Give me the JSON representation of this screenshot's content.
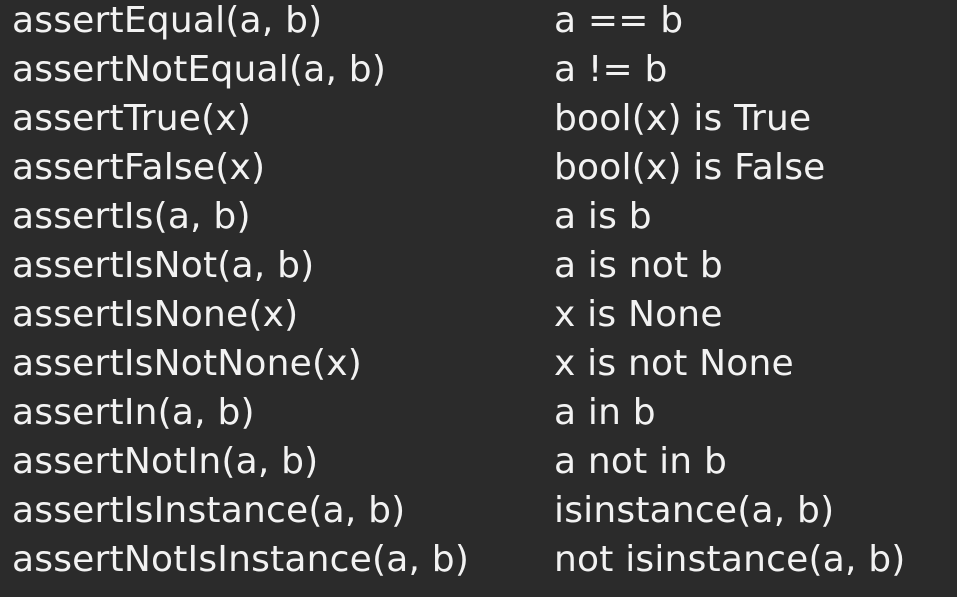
{
  "assertions": [
    {
      "method": "assertEqual(a, b)",
      "equivalent": "a == b"
    },
    {
      "method": "assertNotEqual(a, b)",
      "equivalent": "a != b"
    },
    {
      "method": "assertTrue(x)",
      "equivalent": "bool(x) is True"
    },
    {
      "method": "assertFalse(x)",
      "equivalent": "bool(x) is False"
    },
    {
      "method": "assertIs(a, b)",
      "equivalent": "a is b"
    },
    {
      "method": "assertIsNot(a, b)",
      "equivalent": "a is not b"
    },
    {
      "method": "assertIsNone(x)",
      "equivalent": "x is None"
    },
    {
      "method": "assertIsNotNone(x)",
      "equivalent": "x is not None"
    },
    {
      "method": "assertIn(a, b)",
      "equivalent": "a in b"
    },
    {
      "method": "assertNotIn(a, b)",
      "equivalent": "a not in b"
    },
    {
      "method": "assertIsInstance(a, b)",
      "equivalent": "isinstance(a, b)"
    },
    {
      "method": "assertNotIsInstance(a, b)",
      "equivalent": "not isinstance(a, b)"
    }
  ]
}
